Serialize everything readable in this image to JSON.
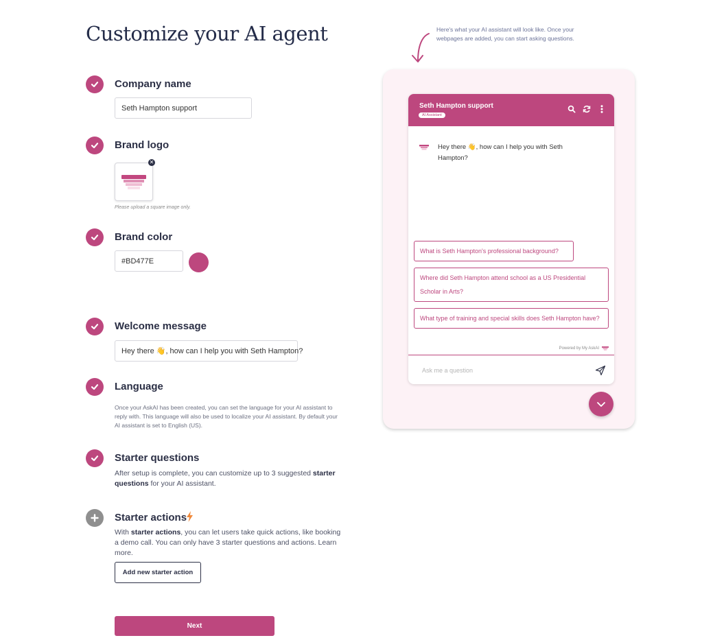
{
  "page": {
    "title": "Customize your AI agent"
  },
  "steps": {
    "company": {
      "title": "Company name",
      "value": "Seth Hampton support"
    },
    "logo": {
      "title": "Brand logo",
      "hint": "Please upload a square image only.",
      "remove_icon": "close-icon"
    },
    "color": {
      "title": "Brand color",
      "value": "#BD477E",
      "swatch": "#BD477E"
    },
    "welcome": {
      "title": "Welcome message",
      "value": "Hey there 👋, how can I help you with Seth Hampton?"
    },
    "language": {
      "title": "Language",
      "description": "Once your AskAI has been created, you can set the language for your AI assistant to reply with. This language will also be used to localize your AI assistant. By default your AI assistant is set to English (US)."
    },
    "starter_questions": {
      "title": "Starter questions",
      "desc_pre": "After setup is complete, you can customize up to 3 suggested ",
      "desc_bold": "starter questions",
      "desc_post": " for your AI assistant."
    },
    "starter_actions": {
      "title": "Starter actions",
      "desc_pre": "With ",
      "desc_bold": "starter actions",
      "desc_post": ", you can let users take quick actions, like booking a demo call. You can only have 3 starter questions and actions. Learn more.",
      "button": "Add new starter action"
    }
  },
  "next_button": "Next",
  "preview": {
    "note": "Here's what your AI assistant will look like. Once your webpages are added, you can start asking questions.",
    "chat": {
      "title": "Seth Hampton support",
      "badge": "AI Assistant",
      "welcome": "Hey there 👋, how can I help you with Seth Hampton?",
      "suggestions": [
        "What is Seth Hampton's professional background?",
        "Where did Seth Hampton attend school as a US Presidential Scholar in Arts?",
        "What type of training and special skills does Seth Hampton have?"
      ],
      "powered_by": "Powered by My AskAI",
      "input_placeholder": "Ask me a question"
    }
  },
  "colors": {
    "brand": "#BD477E",
    "text_dark": "#2B2F45",
    "preview_bg": "#FDF2F6"
  },
  "icons": [
    "check-icon",
    "plus-icon",
    "lightning-icon",
    "search-icon",
    "refresh-icon",
    "more-vertical-icon",
    "send-icon",
    "chevron-down-icon",
    "curved-arrow-icon"
  ]
}
